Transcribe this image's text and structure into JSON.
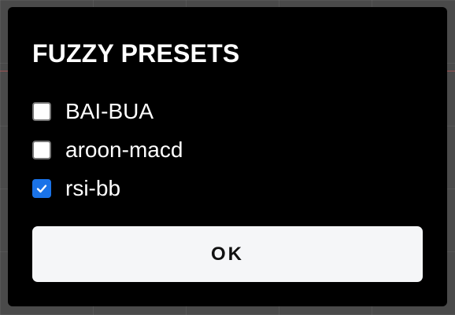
{
  "dialog": {
    "title": "FUZZY PRESETS",
    "presets": [
      {
        "label": "BAI-BUA",
        "checked": false
      },
      {
        "label": "aroon-macd",
        "checked": false
      },
      {
        "label": "rsi-bb",
        "checked": true
      }
    ],
    "ok_label": "OK"
  },
  "colors": {
    "dialog_background": "#000000",
    "checkbox_checked": "#1a73e8",
    "button_background": "#f5f6f8",
    "backdrop": "#4a4a4a"
  },
  "icons": {
    "checkmark": "checkmark-icon"
  }
}
